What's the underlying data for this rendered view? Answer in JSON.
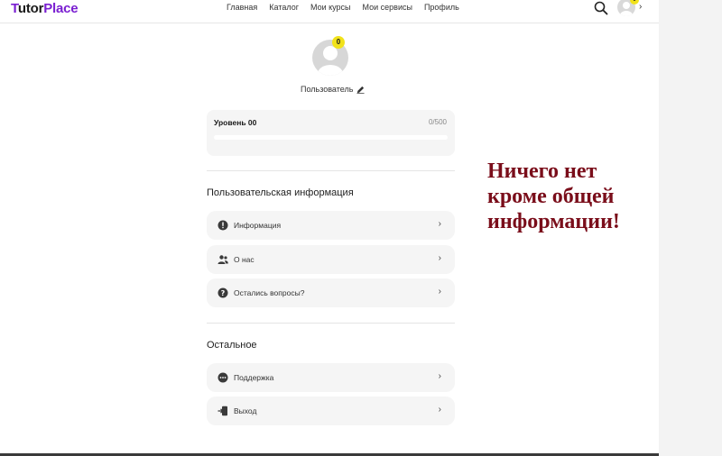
{
  "header": {
    "logo_first": "T",
    "logo_mid": "utor",
    "logo_last": "Place",
    "nav": [
      "Главная",
      "Каталог",
      "Мои курсы",
      "Мои сервисы",
      "Профиль"
    ],
    "avatar_badge": "0",
    "chevron": "›"
  },
  "profile": {
    "badge": "0",
    "username": "Пользователь",
    "edit_icon": "pencil-icon"
  },
  "level": {
    "title": "Уровень 00",
    "points": "0/500",
    "progress_fraction": 0
  },
  "sections": {
    "user_info_title": "Пользовательская информация",
    "other_title": "Остальное"
  },
  "menu_user": [
    {
      "label": "Информация",
      "icon": "info-icon"
    },
    {
      "label": "О нас",
      "icon": "people-icon"
    },
    {
      "label": "Остались вопросы?",
      "icon": "question-icon"
    }
  ],
  "menu_other": [
    {
      "label": "Поддержка",
      "icon": "chat-icon"
    },
    {
      "label": "Выход",
      "icon": "exit-icon"
    }
  ],
  "annotation": "Ничего нет кроме общей информации!",
  "colors": {
    "brand": "#7a1fd1",
    "badge": "#f1e21b",
    "annotation": "#7a0d1a"
  }
}
